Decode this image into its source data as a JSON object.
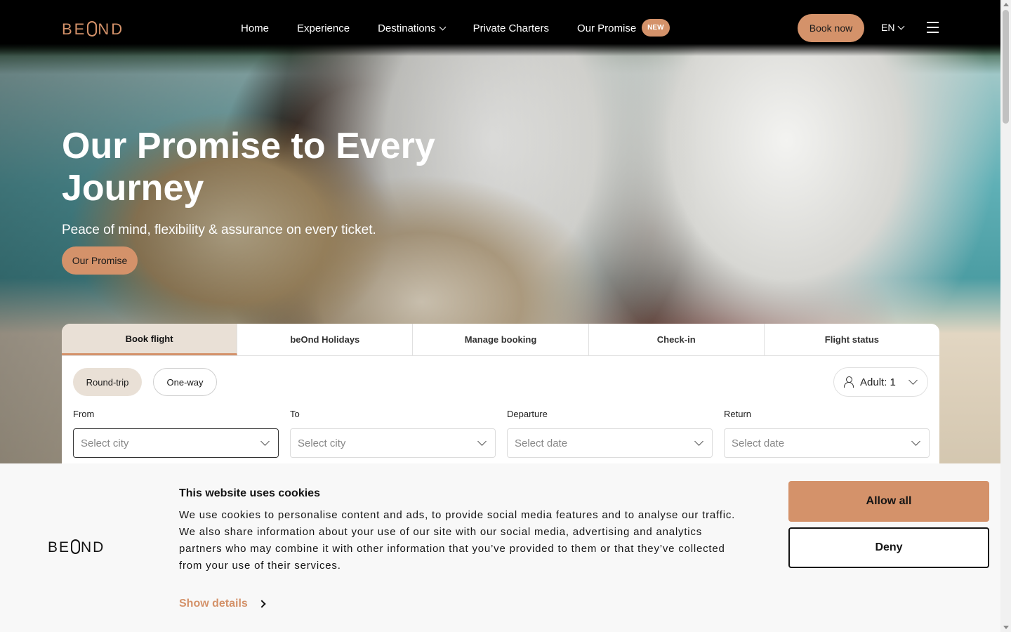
{
  "brand": {
    "logo_pre": "BE",
    "logo_post": "ND",
    "accent_color": "#d4926a"
  },
  "nav": {
    "links": [
      "Home",
      "Experience",
      "Destinations",
      "Private Charters",
      "Our Promise"
    ],
    "new_badge": "NEW",
    "book_now": "Book now",
    "language": "EN"
  },
  "hero": {
    "title": "Our Promise to Every Journey",
    "subtitle": "Peace of mind, flexibility & assurance on every ticket.",
    "cta": "Our Promise"
  },
  "booking": {
    "tabs": [
      "Book flight",
      "beOnd Holidays",
      "Manage booking",
      "Check-in",
      "Flight status"
    ],
    "active_tab": "Book flight",
    "trip_types": [
      "Round-trip",
      "One-way"
    ],
    "selected_trip": "Round-trip",
    "passengers": "Adult: 1",
    "fields": [
      {
        "label": "From",
        "placeholder": "Select city"
      },
      {
        "label": "To",
        "placeholder": "Select city"
      },
      {
        "label": "Departure",
        "placeholder": "Select date"
      },
      {
        "label": "Return",
        "placeholder": "Select date"
      }
    ]
  },
  "cookie": {
    "title": "This website uses cookies",
    "text": "We use cookies to personalise content and ads, to provide social media features and to analyse our traffic. We also share information about your use of our site with our social media, advertising and analytics partners who may combine it with other information that you’ve provided to them or that they’ve collected from your use of their services.",
    "show_details": "Show details",
    "allow_all": "Allow all",
    "deny": "Deny"
  }
}
